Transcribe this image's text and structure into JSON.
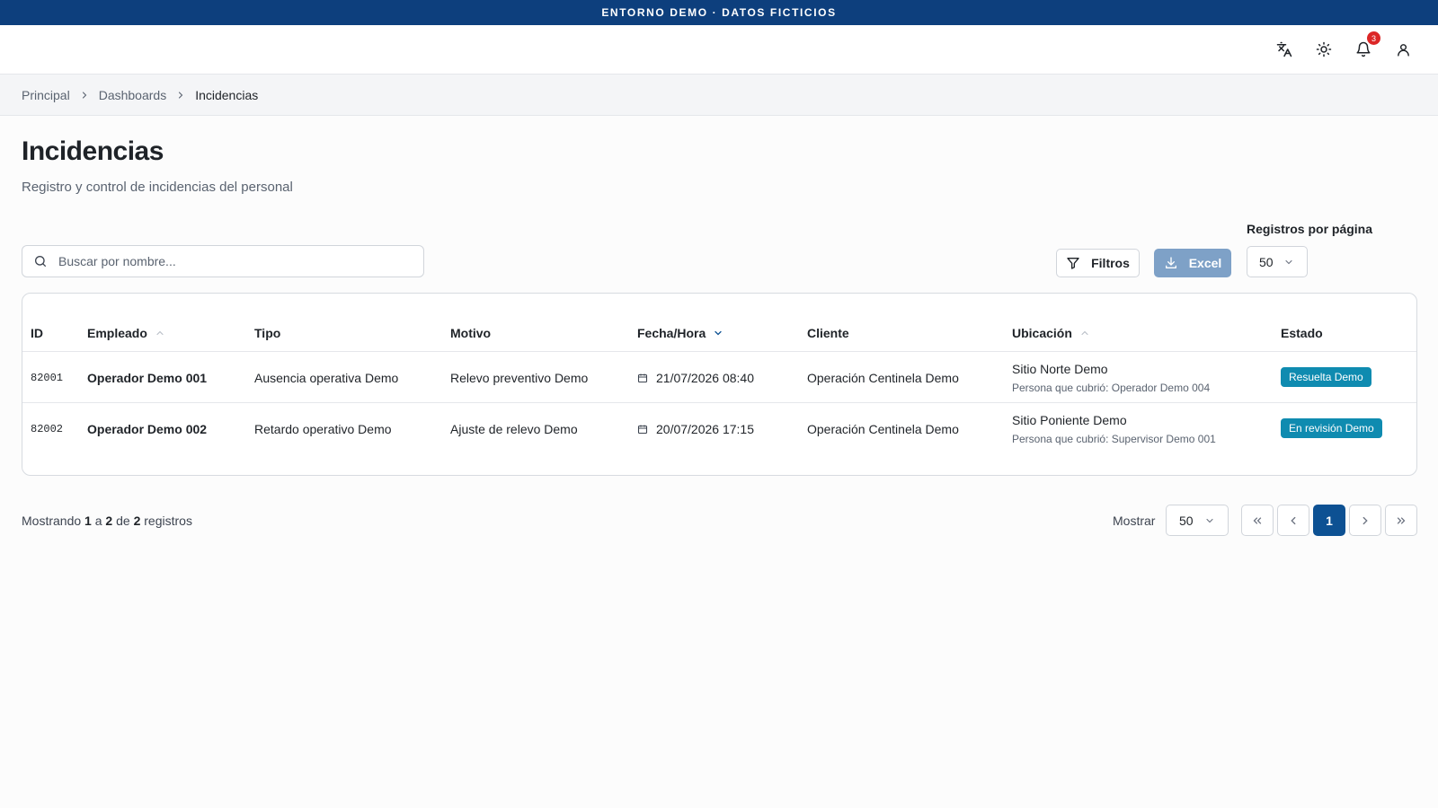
{
  "banner": {
    "text": "ENTORNO DEMO · DATOS FICTICIOS"
  },
  "topbar": {
    "icons": [
      "translate-icon",
      "sun-icon",
      "bell-icon",
      "user-icon"
    ],
    "notification_count": "3"
  },
  "breadcrumb": [
    "Principal",
    "Dashboards",
    "Incidencias"
  ],
  "page": {
    "title": "Incidencias",
    "subtitle": "Registro y control de incidencias del personal"
  },
  "toolbar": {
    "search_placeholder": "Buscar por nombre...",
    "search_value": "",
    "filters_label": "Filtros",
    "excel_label": "Excel",
    "per_page_label": "Registros por página",
    "per_page_value": "50"
  },
  "table": {
    "columns": [
      "ID",
      "Empleado",
      "Tipo",
      "Motivo",
      "Fecha/Hora",
      "Cliente",
      "Ubicación",
      "Estado"
    ],
    "rows": [
      {
        "id": "82001",
        "employee": "Operador Demo 001",
        "type": "Ausencia operativa Demo",
        "reason": "Relevo preventivo Demo",
        "datetime": "21/07/2026 08:40",
        "client": "Operación Centinela Demo",
        "location": "Sitio Norte Demo",
        "covered_by": "Persona que cubrió: Operador Demo 004",
        "status": "Resuelta Demo"
      },
      {
        "id": "82002",
        "employee": "Operador Demo 002",
        "type": "Retardo operativo Demo",
        "reason": "Ajuste de relevo Demo",
        "datetime": "20/07/2026 17:15",
        "client": "Operación Centinela Demo",
        "location": "Sitio Poniente Demo",
        "covered_by": "Persona que cubrió: Supervisor Demo 001",
        "status": "En revisión Demo"
      }
    ]
  },
  "footer": {
    "summary_prefix": "Mostrando",
    "summary_from": "1",
    "summary_a": "a",
    "summary_to": "2",
    "summary_de": "de",
    "summary_total": "2",
    "summary_suffix": "registros",
    "show_label": "Mostrar",
    "show_value": "50",
    "current_page": "1"
  },
  "colors": {
    "banner_bg": "#0d3f7d",
    "primary": "#0d5193",
    "excel_disabled": "#7ea1c7",
    "status_badge": "#0f8bb0",
    "notification_badge": "#dc2626"
  }
}
